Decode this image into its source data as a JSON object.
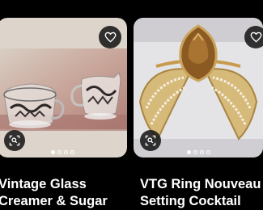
{
  "listings": [
    {
      "title_line1": "Vintage Glass",
      "title_line2": "Creamer & Sugar",
      "image_pages": 4,
      "active_page": 1,
      "icons": {
        "favorite": "heart-icon",
        "visual_search": "lens-search-icon"
      }
    },
    {
      "title_line1": "VTG Ring Nouveau",
      "title_line2": "Setting Cocktail",
      "image_pages": 4,
      "active_page": 1,
      "icons": {
        "favorite": "heart-icon",
        "visual_search": "lens-search-icon"
      }
    }
  ]
}
